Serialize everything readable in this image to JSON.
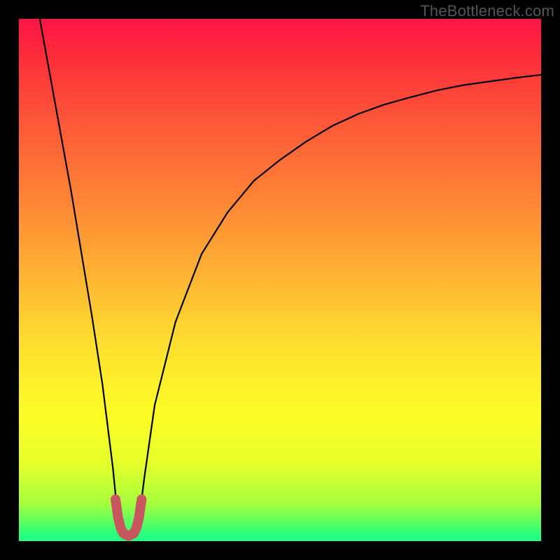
{
  "watermark": "TheBottleneck.com",
  "chart_data": {
    "type": "line",
    "title": "",
    "xlabel": "",
    "ylabel": "",
    "xlim": [
      0,
      100
    ],
    "ylim": [
      0,
      100
    ],
    "series": [
      {
        "name": "bottleneck-curve",
        "x": [
          4,
          6,
          8,
          10,
          12,
          14,
          16,
          18,
          19,
          20,
          21,
          22,
          23,
          24,
          26,
          30,
          35,
          40,
          45,
          50,
          55,
          60,
          65,
          70,
          75,
          80,
          85,
          90,
          95,
          100
        ],
        "y": [
          100,
          89,
          78,
          67,
          55,
          43,
          30,
          14,
          4,
          1,
          0.5,
          1,
          4,
          12,
          26,
          42,
          55,
          63,
          69,
          73,
          76.5,
          79.5,
          81.8,
          83.6,
          85,
          86.3,
          87.3,
          88,
          88.7,
          89.3
        ]
      },
      {
        "name": "optimal-marker",
        "x": [
          18.5,
          19,
          19.5,
          20,
          20.5,
          21,
          21.5,
          22,
          22.5,
          23,
          23.5
        ],
        "y": [
          8,
          4.5,
          2.5,
          1.5,
          1.2,
          1,
          1.2,
          1.5,
          2.5,
          4.5,
          8
        ]
      }
    ],
    "colors": {
      "curve": "#000000",
      "marker": "#c7565e",
      "gradient_top": "#fe1445",
      "gradient_mid": "#fede2f",
      "gradient_bottom": "#23ff80"
    }
  }
}
